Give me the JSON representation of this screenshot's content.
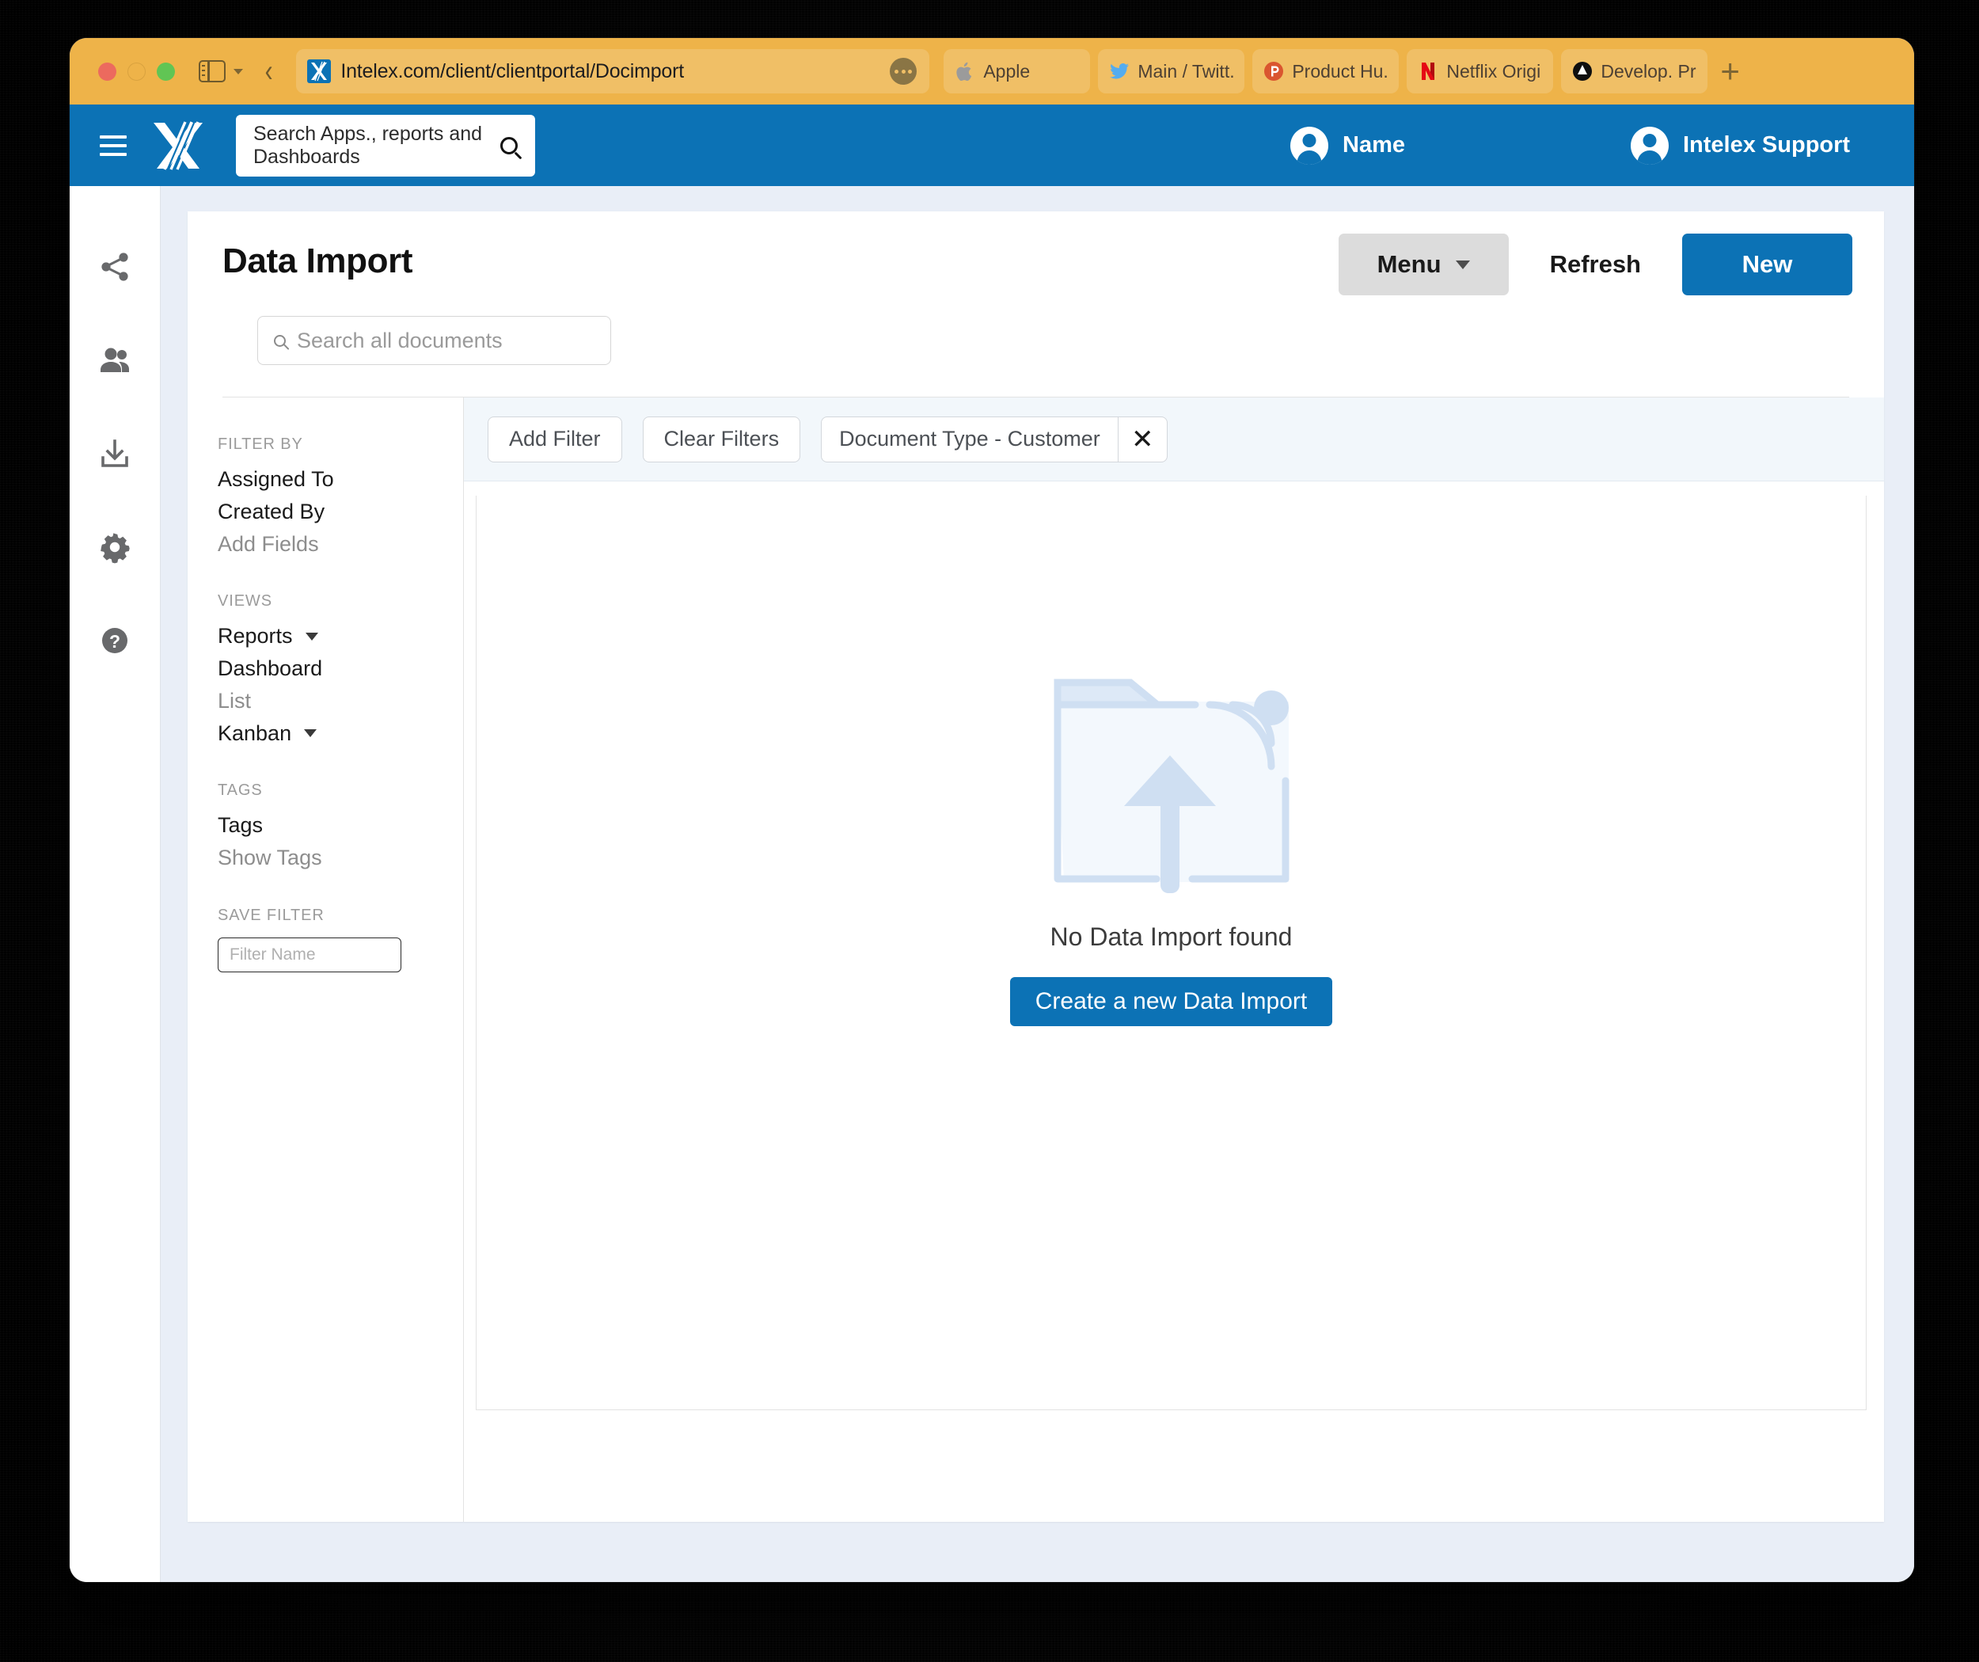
{
  "browser": {
    "traffic_lights": [
      "close",
      "minimize",
      "zoom"
    ],
    "sidebar_toggle_icon": "sidebar-icon",
    "back_button_icon": "chevron-left-icon",
    "url": "Intelex.com/client/clientportal/Docimport",
    "url_favicon": "intelex-favicon",
    "url_more_icon": "ellipsis-icon",
    "new_tab_label": "+",
    "tabs": [
      {
        "label": "Apple",
        "icon": "apple-icon"
      },
      {
        "label": "Main / Twitt...",
        "icon": "twitter-icon"
      },
      {
        "label": "Product Hu...",
        "icon": "producthunt-icon"
      },
      {
        "label": "Netflix Origi...",
        "icon": "netflix-icon"
      },
      {
        "label": "Develop. Pr...",
        "icon": "dropbox-icon"
      }
    ]
  },
  "appbar": {
    "menu_icon": "hamburger-icon",
    "logo": "intelex-logo",
    "search_placeholder": "Search Apps., reports and Dashboards",
    "search_icon": "search-icon",
    "user_name": "Name",
    "support_name": "Intelex Support",
    "brand_color": "#0c72b5"
  },
  "rail": {
    "items": [
      {
        "icon": "share-icon",
        "name": "share"
      },
      {
        "icon": "people-icon",
        "name": "people"
      },
      {
        "icon": "download-icon",
        "name": "download"
      },
      {
        "icon": "gear-icon",
        "name": "settings"
      },
      {
        "icon": "help-icon",
        "name": "help"
      }
    ]
  },
  "page": {
    "title": "Data Import",
    "menu_label": "Menu",
    "refresh_label": "Refresh",
    "new_label": "New",
    "doc_search_placeholder": "Search all documents"
  },
  "filters_panel": {
    "filter_by": {
      "title": "FILTER BY",
      "items": [
        {
          "label": "Assigned To",
          "muted": false,
          "caret": false
        },
        {
          "label": "Created By",
          "muted": false,
          "caret": false
        },
        {
          "label": "Add Fields",
          "muted": true,
          "caret": false
        }
      ]
    },
    "views": {
      "title": "VIEWS",
      "items": [
        {
          "label": "Reports",
          "muted": false,
          "caret": true
        },
        {
          "label": "Dashboard",
          "muted": false,
          "caret": false
        },
        {
          "label": "List",
          "muted": true,
          "caret": false
        },
        {
          "label": "Kanban",
          "muted": false,
          "caret": true
        }
      ]
    },
    "tags": {
      "title": "TAGS",
      "items": [
        {
          "label": "Tags",
          "muted": false,
          "caret": false
        },
        {
          "label": "Show Tags",
          "muted": true,
          "caret": false
        }
      ]
    },
    "save_filter": {
      "title": "SAVE FILTER",
      "input_placeholder": "Filter Name",
      "input_value": ""
    }
  },
  "filter_toolbar": {
    "add_filter_label": "Add Filter",
    "clear_filters_label": "Clear Filters",
    "active_filter_label": "Document Type - Customer",
    "remove_icon": "close-icon"
  },
  "empty_state": {
    "illustration": "folder-upload-icon",
    "message": "No Data Import found",
    "cta_label": "Create a new Data Import"
  }
}
